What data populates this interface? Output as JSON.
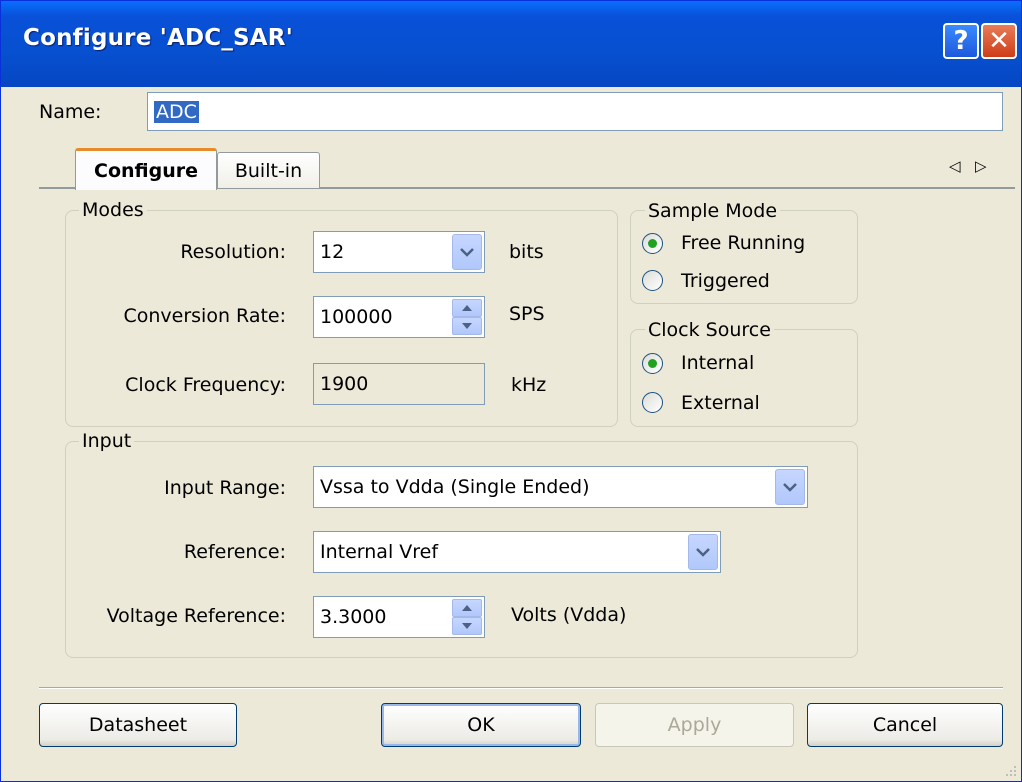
{
  "window": {
    "title": "Configure 'ADC_SAR'",
    "help_label": "?",
    "close_label": "✕"
  },
  "name": {
    "label": "Name:",
    "value": "ADC"
  },
  "tabs": [
    {
      "label": "Configure"
    },
    {
      "label": "Built-in"
    }
  ],
  "tab_scroll": {
    "left": "◁",
    "right": "▷"
  },
  "modes": {
    "title": "Modes",
    "resolution": {
      "label": "Resolution:",
      "value": "12",
      "unit": "bits"
    },
    "conversion_rate": {
      "label": "Conversion Rate:",
      "value": "100000",
      "unit": "SPS"
    },
    "clock_frequency": {
      "label": "Clock Frequency:",
      "value": "1900",
      "unit": "kHz"
    }
  },
  "sample_mode": {
    "title": "Sample Mode",
    "options": [
      "Free Running",
      "Triggered"
    ],
    "selected": "Free Running"
  },
  "clock_source": {
    "title": "Clock Source",
    "options": [
      "Internal",
      "External"
    ],
    "selected": "Internal"
  },
  "input": {
    "title": "Input",
    "input_range": {
      "label": "Input Range:",
      "value": "Vssa to Vdda (Single Ended)"
    },
    "reference": {
      "label": "Reference:",
      "value": "Internal Vref"
    },
    "voltage_reference": {
      "label": "Voltage Reference:",
      "value": "3.3000",
      "unit": "Volts (Vdda)"
    }
  },
  "buttons": {
    "datasheet": "Datasheet",
    "ok": "OK",
    "apply": "Apply",
    "cancel": "Cancel"
  },
  "colors": {
    "title_bar": "#0851d8",
    "dialog_bg": "#ece9d8",
    "selection": "#316ac5",
    "radio_dot": "#21a121"
  }
}
